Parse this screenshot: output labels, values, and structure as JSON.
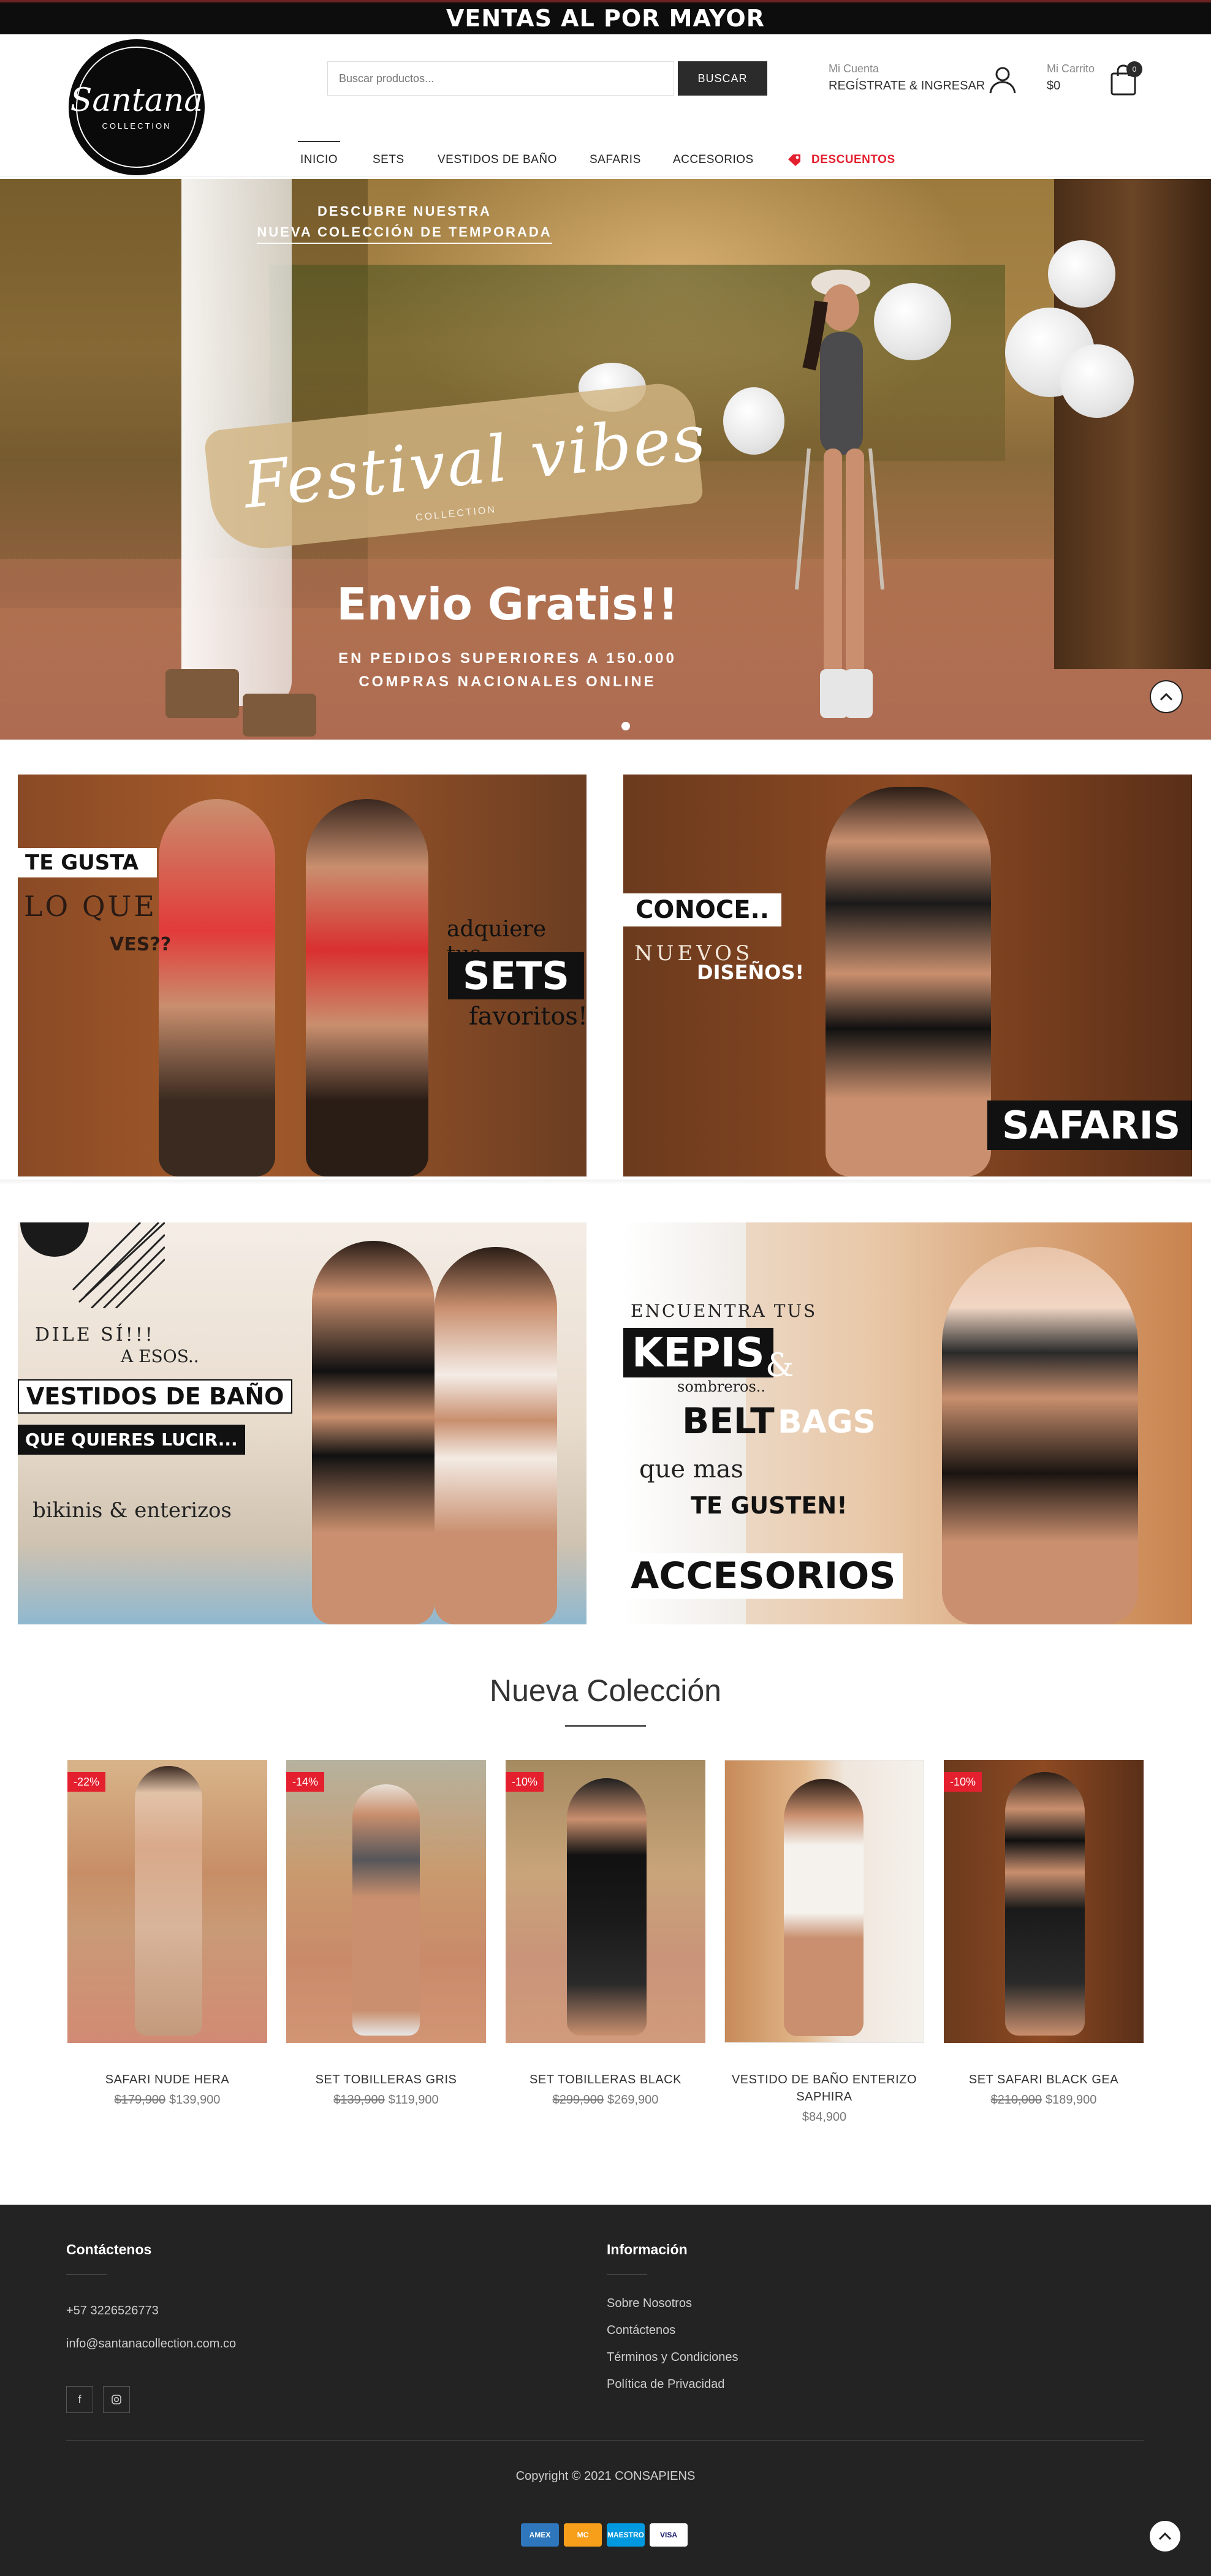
{
  "top_bar": {
    "text": "VENTAS AL POR MAYOR"
  },
  "header": {
    "logo_name": "Santana",
    "logo_sub": "COLLECTION",
    "search_placeholder": "Buscar productos...",
    "search_button": "BUSCAR",
    "account_small": "Mi Cuenta",
    "account_big": "REGÍSTRATE & INGRESAR",
    "cart_small": "Mi Carrito",
    "cart_total": "$0",
    "cart_count": "0"
  },
  "nav": {
    "items": [
      "INICIO",
      "SETS",
      "VESTIDOS DE BAÑO",
      "SAFARIS",
      "ACCESORIOS"
    ],
    "discount": "DESCUENTOS"
  },
  "hero": {
    "top_line1": "DESCUBRE NUESTRA",
    "top_line2": "NUEVA COLECCIÓN DE TEMPORADA",
    "script": "Festival vibes",
    "script_small": "COLLECTION",
    "big": "Envio Gratis!!",
    "sub1": "EN PEDIDOS SUPERIORES A 150.000",
    "sub2": "COMPRAS NACIONALES ONLINE"
  },
  "banners": {
    "b1": {
      "t1": "TE GUSTA",
      "t2": "LO QUE",
      "t3": "VES??",
      "t4": "adquiere tus",
      "t5": "SETS",
      "t6": "favoritos!"
    },
    "b2": {
      "t1": "CONOCE..",
      "t2": "NUEVOS",
      "t3": "DISEÑOS!",
      "t4": "SAFARIS"
    },
    "b3": {
      "t1": "DILE SÍ!!!",
      "t2": "A ESOS..",
      "t3": "VESTIDOS DE BAÑO",
      "t4": "QUE QUIERES LUCIR...",
      "t5": "bikinis & enterizos"
    },
    "b4": {
      "t1": "ENCUENTRA TUS",
      "t2": "KEPIS",
      "t3": "&",
      "t4": "sombreros..",
      "t5": "BELT",
      "t6": "BAGS",
      "t7": "que mas",
      "t8": "TE GUSTEN!",
      "t9": "ACCESORIOS"
    }
  },
  "collection": {
    "title": "Nueva Colección",
    "products": [
      {
        "badge": "-22%",
        "name": "SAFARI NUDE HERA",
        "old": "$179,900",
        "price": "$139,900"
      },
      {
        "badge": "-14%",
        "name": "SET TOBILLERAS GRIS",
        "old": "$139,900",
        "price": "$119,900"
      },
      {
        "badge": "-10%",
        "name": "SET TOBILLERAS BLACK",
        "old": "$299,900",
        "price": "$269,900"
      },
      {
        "badge": "",
        "name": "VESTIDO DE BAÑO ENTERIZO SAPHIRA",
        "old": "",
        "price": "$84,900"
      },
      {
        "badge": "-10%",
        "name": "SET SAFARI BLACK GEA",
        "old": "$210,000",
        "price": "$189,900"
      }
    ]
  },
  "footer": {
    "contact_title": "Contáctenos",
    "phone": "+57 3226526773",
    "email": "info@santanacollection.com.co",
    "info_title": "Información",
    "links": [
      "Sobre Nosotros",
      "Contáctenos",
      "Términos y Condiciones",
      "Política de Privacidad"
    ],
    "copyright": "Copyright © 2021 CONSAPIENS",
    "cards": [
      "AMEX",
      "MC",
      "MAESTRO",
      "VISA"
    ]
  },
  "colors": {
    "accent_red": "#e4202f",
    "dark": "#232323",
    "button": "#2b2b2b"
  },
  "icons": [
    "user-icon",
    "shopping-bag-icon",
    "tag-icon",
    "arrow-up-icon",
    "facebook-icon",
    "instagram-icon"
  ]
}
